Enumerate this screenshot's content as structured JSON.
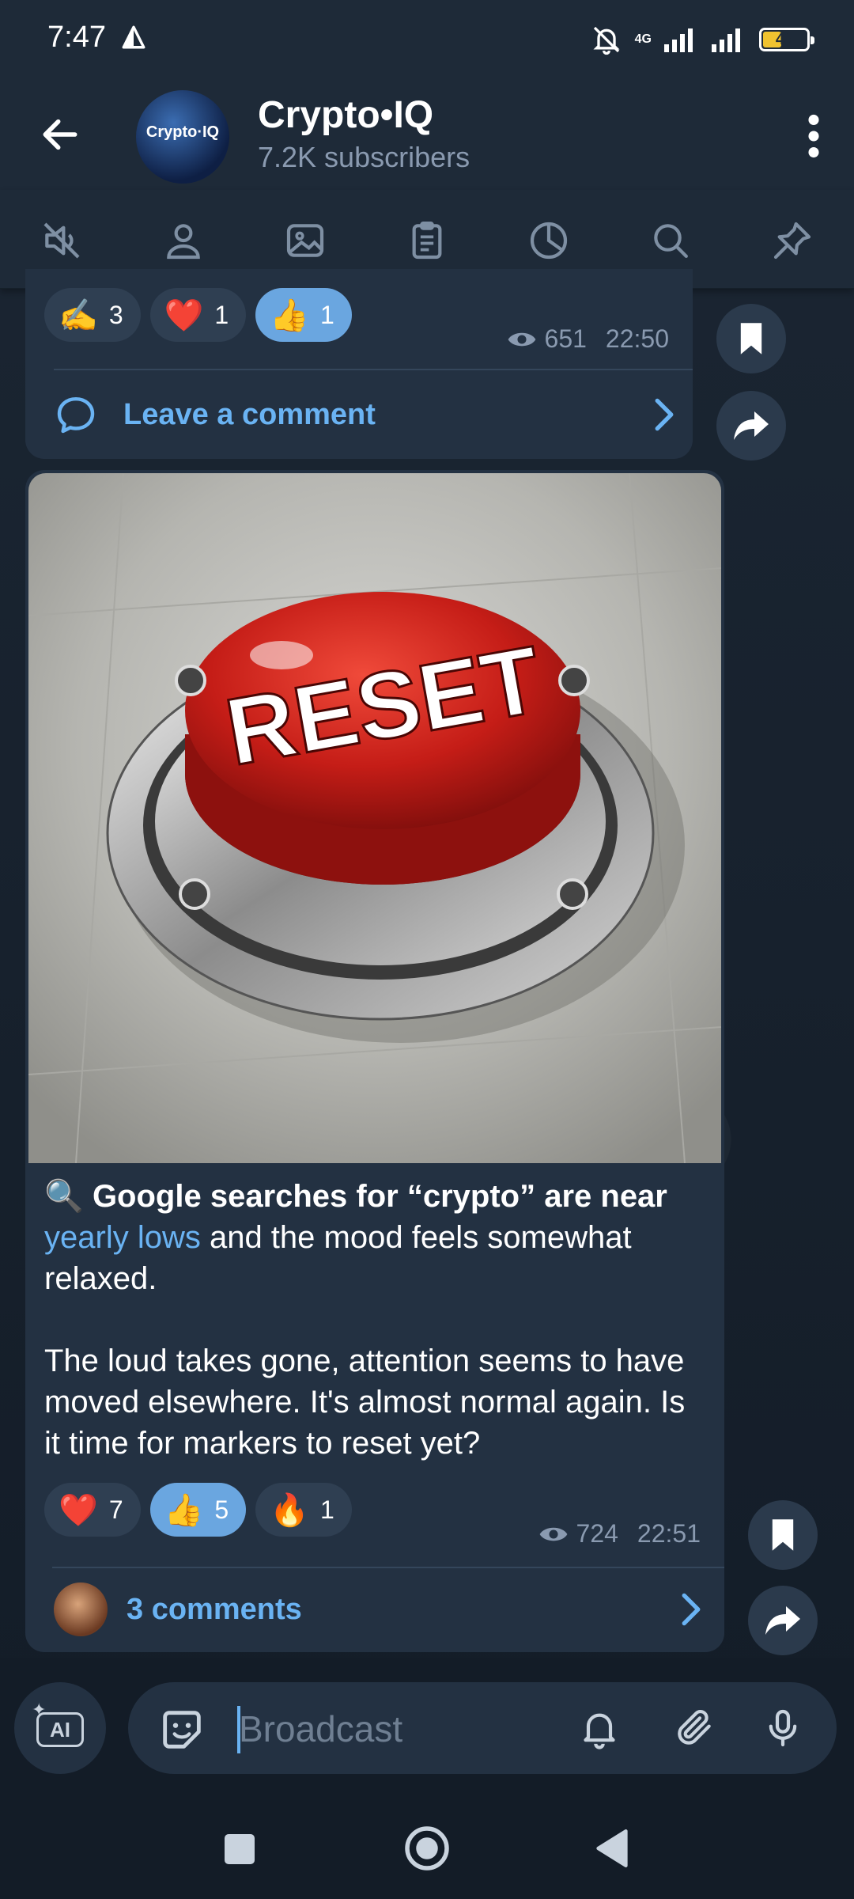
{
  "status_bar": {
    "time": "7:47",
    "battery": "43",
    "battery_level": 0.43,
    "network": "4G"
  },
  "header": {
    "title": "Crypto•IQ",
    "subtitle": "7.2K subscribers",
    "avatar_text": "Crypto·IQ"
  },
  "tabs": [
    "mute-icon",
    "members-icon",
    "media-icon",
    "files-icon",
    "stats-icon",
    "search-icon",
    "pin-icon"
  ],
  "post1": {
    "reactions": [
      {
        "emoji": "✍️",
        "count": "3",
        "active": false
      },
      {
        "emoji": "❤️",
        "count": "1",
        "active": false
      },
      {
        "emoji": "👍",
        "count": "1",
        "active": true
      }
    ],
    "views": "651",
    "time": "22:50",
    "comment_label": "Leave a comment"
  },
  "post2": {
    "image_text": "RESET",
    "text_emoji": "🔍",
    "text_bold": "Google searches for “crypto” are near",
    "text_link": "yearly lows",
    "text_rest": " and the mood feels somewhat relaxed.",
    "text_para2": "The loud takes gone, attention seems to have moved elsewhere. It's almost normal again.  Is it time for markers to reset yet?",
    "reactions": [
      {
        "emoji": "❤️",
        "count": "7",
        "active": false
      },
      {
        "emoji": "👍",
        "count": "5",
        "active": true
      },
      {
        "emoji": "🔥",
        "count": "1",
        "active": false
      }
    ],
    "views": "724",
    "time": "22:51",
    "comments_label": "3 comments"
  },
  "input": {
    "placeholder": "Broadcast",
    "ai_label": "AI"
  }
}
